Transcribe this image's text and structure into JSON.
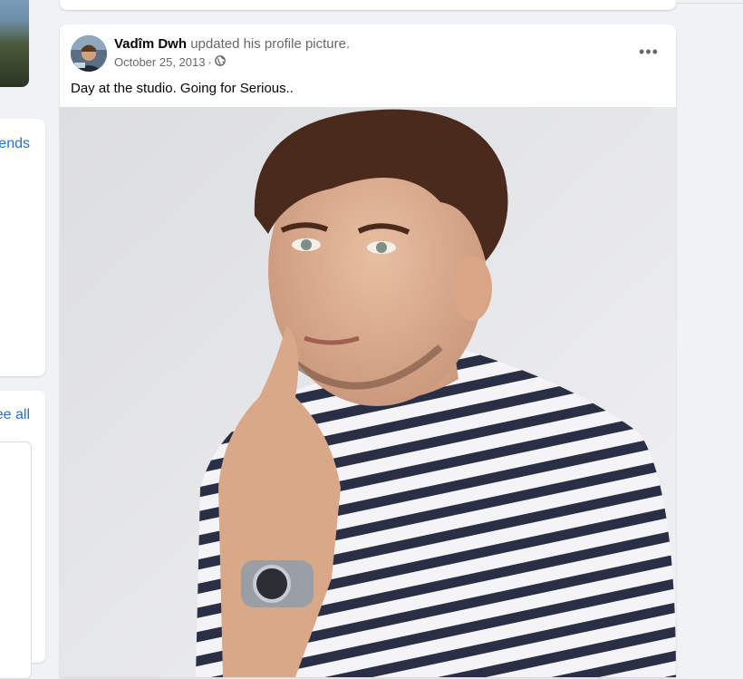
{
  "left_column": {
    "card2_link": "ends",
    "card3_link": "ee all"
  },
  "post": {
    "author": "Vadîm Dwh",
    "action": "updated his profile picture.",
    "date": "October 25, 2013",
    "separator": "·",
    "privacy_icon": "globe-icon",
    "more_icon": "•••",
    "caption": "Day at the studio. Going for Serious..",
    "photo_subject": "profile-photo"
  }
}
